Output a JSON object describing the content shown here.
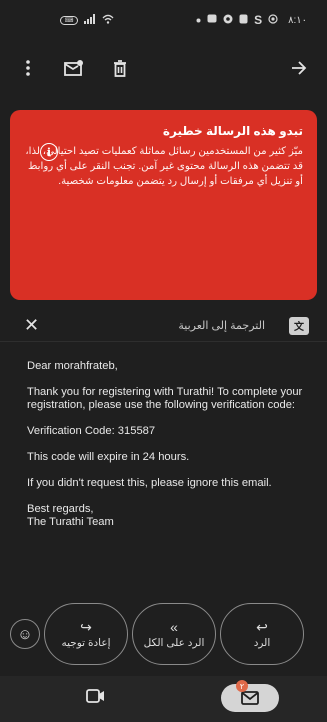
{
  "status_bar": {
    "left_icons": [
      "rtt-icon",
      "signal-icon",
      "wifi-icon"
    ],
    "rtt_label": "⌨",
    "right_icons": [
      "dot-icon",
      "app-icon",
      "camera-icon",
      "shield-icon",
      "s-icon",
      "record-icon"
    ],
    "s_label": "S",
    "time": "٨:١٠"
  },
  "app_bar": {
    "icons": [
      "more-vert-icon",
      "mark-unread-icon",
      "delete-icon",
      "forward-arrow-icon"
    ]
  },
  "warning": {
    "title": "تبدو هذه الرسالة خطيرة",
    "body": "ميّز كثير من المستخدمين رسائل مماثلة كعمليات تصيد احتيالي، لذا، قد تتضمن هذه الرسالة محتوى غير آمن. تجنب النقر على أي روابط أو تنزيل أي مرفقات أو إرسال رد يتضمن معلومات شخصية.",
    "info_symbol": "i",
    "color": "#d93025"
  },
  "translate_bar": {
    "close_symbol": "✕",
    "label": "الترجمة إلى العربية",
    "icon_text": "文"
  },
  "email": {
    "greeting": "Dear morahfrateb,",
    "p1": "Thank you for registering with Turathi! To complete your registration, please use the following verification code:",
    "code_line": "Verification Code: 315587",
    "expiry": "This code will expire in 24 hours.",
    "ignore": "If you didn't request this, please ignore this email.",
    "signoff": "Best regards,",
    "team": "The Turathi Team"
  },
  "reply_actions": {
    "forward_label": "إعادة توجيه",
    "forward_glyph": "↪",
    "reply_all_label": "الرد على الكل",
    "reply_all_glyph": "«",
    "reply_label": "الرد",
    "reply_glyph": "↩",
    "emoji_glyph": "☺"
  },
  "bottom_nav": {
    "badge_count": "٢",
    "badge_color": "#e06a4a"
  }
}
